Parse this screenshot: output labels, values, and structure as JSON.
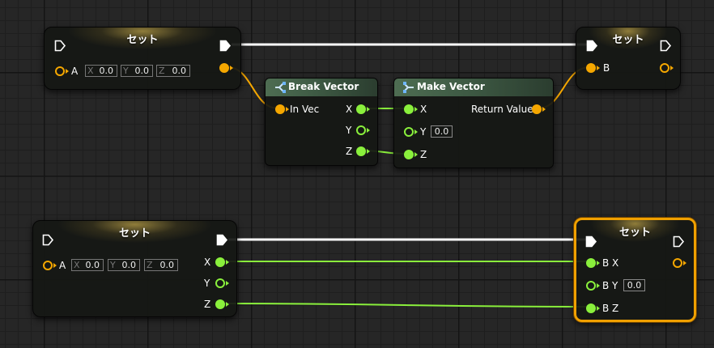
{
  "graph": {
    "set_node_title": "セット",
    "break_vector": {
      "title": "Break Vector",
      "in_label": "In Vec",
      "out_x": "X",
      "out_y": "Y",
      "out_z": "Z"
    },
    "make_vector": {
      "title": "Make Vector",
      "in_x": "X",
      "in_y": "Y",
      "y_value": "0.0",
      "in_z": "Z",
      "return_label": "Return Value"
    },
    "set_a_top": {
      "pin_label": "A",
      "components": [
        {
          "axis": "X",
          "value": "0.0"
        },
        {
          "axis": "Y",
          "value": "0.0"
        },
        {
          "axis": "Z",
          "value": "0.0"
        }
      ]
    },
    "set_b_top": {
      "pin_label": "B"
    },
    "set_a_bottom": {
      "pin_label": "A",
      "components": [
        {
          "axis": "X",
          "value": "0.0"
        },
        {
          "axis": "Y",
          "value": "0.0"
        },
        {
          "axis": "Z",
          "value": "0.0"
        }
      ],
      "out_x": "X",
      "out_y": "Y",
      "out_z": "Z"
    },
    "set_b_bottom": {
      "bx_label": "B X",
      "by_label": "B Y",
      "by_value": "0.0",
      "bz_label": "B Z"
    }
  },
  "colors": {
    "exec_wire": "#ffffff",
    "vector_pin": "#f5a700",
    "float_pin": "#8af03c",
    "selection": "#f0a000"
  },
  "icons": {
    "break_vector": "break-struct-icon",
    "make_vector": "make-struct-icon"
  }
}
